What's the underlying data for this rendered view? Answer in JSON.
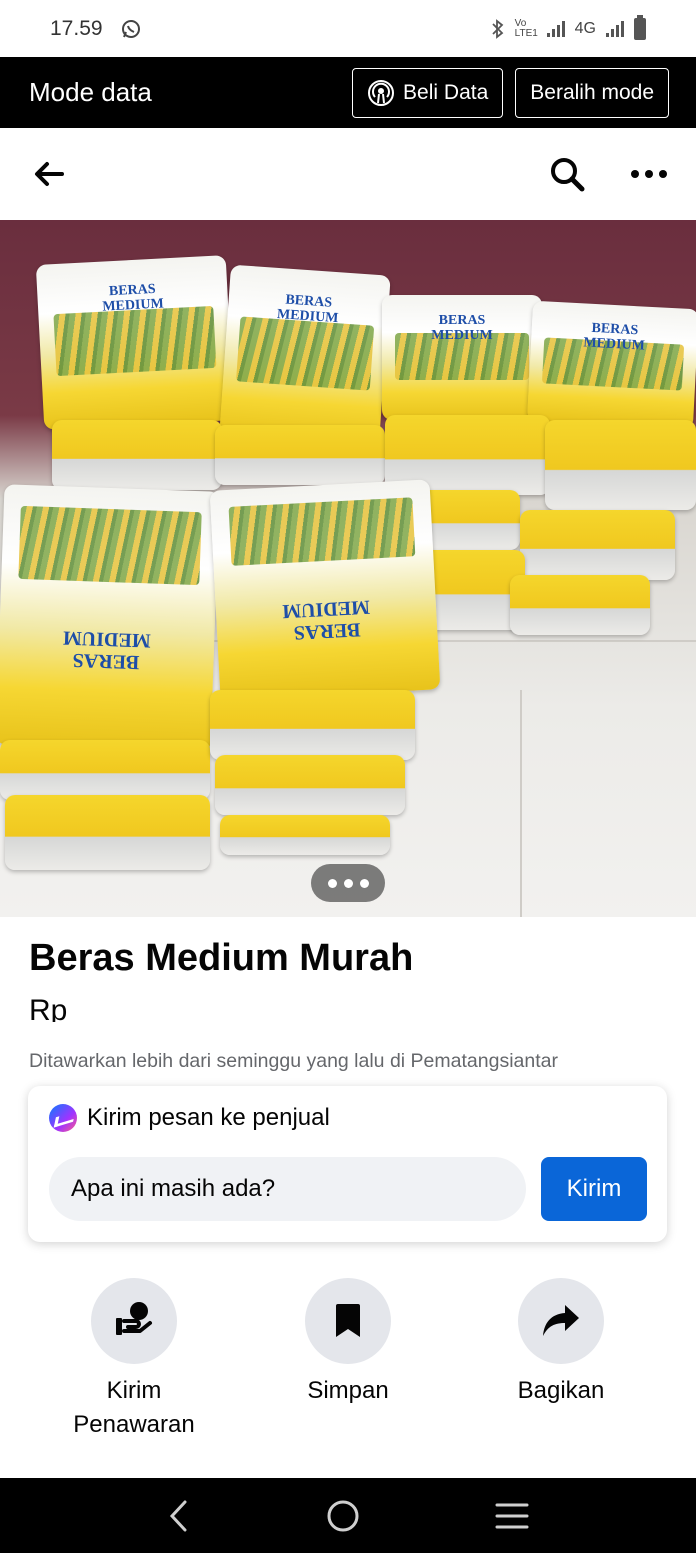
{
  "status_bar": {
    "time": "17.59",
    "network_type": "4G",
    "volte_label": "Vo LTE1",
    "icons": [
      "whatsapp-icon",
      "bluetooth-icon",
      "signal-icon",
      "battery-icon"
    ]
  },
  "data_mode_bar": {
    "title": "Mode data",
    "buy_data_label": "Beli Data",
    "switch_mode_label": "Beralih mode"
  },
  "nav_bar": {
    "icons": [
      "back-arrow-icon",
      "search-icon",
      "more-icon"
    ]
  },
  "photo": {
    "sack_text_line1": "BERAS",
    "sack_text_line2": "MEDIUM",
    "carousel_dot_count": 3
  },
  "listing": {
    "title": "Beras Medium Murah",
    "price": "Rp",
    "meta": "Ditawarkan lebih dari seminggu yang lalu di Pematangsiantar"
  },
  "message_card": {
    "heading": "Kirim pesan ke penjual",
    "input_value": "Apa ini masih ada?",
    "send_label": "Kirim"
  },
  "actions": [
    {
      "label": "Kirim\nPenawaran",
      "icon": "make-offer-icon"
    },
    {
      "label": "Simpan",
      "icon": "bookmark-icon"
    },
    {
      "label": "Bagikan",
      "icon": "share-icon"
    }
  ],
  "colors": {
    "accent_blue": "#0a66d8",
    "data_bar_bg": "#000000",
    "action_circle_bg": "#e4e6eb",
    "meta_text": "#65676b"
  }
}
